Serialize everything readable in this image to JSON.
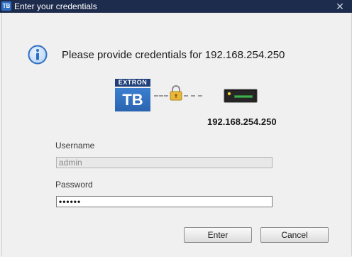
{
  "window": {
    "app_icon_text": "TB",
    "title": "Enter your credentials",
    "close_glyph": "✕"
  },
  "header": {
    "prompt": "Please provide credentials for 192.168.254.250"
  },
  "connection": {
    "logo_brand": "EXTRON",
    "logo_text": "TB",
    "device_ip": "192.168.254.250"
  },
  "form": {
    "username_label": "Username",
    "username_value": "admin",
    "password_label": "Password",
    "password_value": "••••••"
  },
  "buttons": {
    "enter_label": "Enter",
    "cancel_label": "Cancel"
  },
  "colors": {
    "titlebar": "#1d2b4c",
    "accent": "#2f6fc2"
  }
}
